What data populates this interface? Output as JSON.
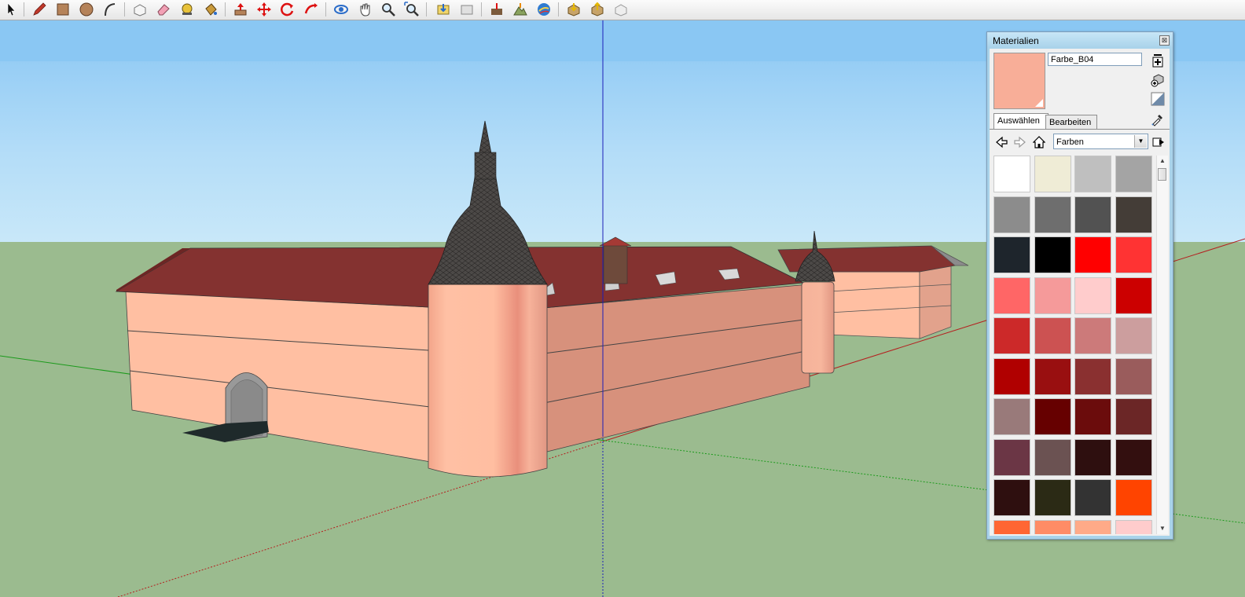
{
  "toolbar": {
    "tools": [
      "select-icon",
      "pencil-icon",
      "rectangle-icon",
      "circle-icon",
      "arc-icon",
      "make-component-icon",
      "eraser-icon",
      "tape-measure-icon",
      "paint-bucket-icon",
      "push-pull-icon",
      "move-icon",
      "rotate-icon",
      "follow-me-icon",
      "orbit-icon",
      "pan-icon",
      "zoom-icon",
      "zoom-extents-icon",
      "get-models-icon",
      "share-model-icon",
      "add-location-icon",
      "toggle-terrain-icon",
      "google-earth-icon",
      "get-components-icon",
      "share-component-icon",
      "extension-icon"
    ]
  },
  "panel": {
    "title": "Materialien",
    "close_label": "⊠",
    "material_name": "Farbe_B04",
    "current_color": "#f8ae98",
    "tabs": [
      "Auswählen",
      "Bearbeiten"
    ],
    "active_tab": "Auswählen",
    "collection": "Farben",
    "swatches": [
      "#ffffff",
      "#efecd6",
      "#bfbfbf",
      "#a4a4a4",
      "#8c8c8c",
      "#6e6e6e",
      "#525252",
      "#443d37",
      "#1e252c",
      "#000000",
      "#ff0000",
      "#ff3333",
      "#ff6666",
      "#f59a9a",
      "#ffcccc",
      "#cc0000",
      "#cc2929",
      "#cc5252",
      "#cc7a7a",
      "#cc9e9e",
      "#b00000",
      "#990f10",
      "#8a3030",
      "#9a5c5c",
      "#997a7a",
      "#660000",
      "#6b0c0c",
      "#6b2626",
      "#6b3645",
      "#6b5252",
      "#2e0f0f",
      "#330f0f",
      "#2e0f0f",
      "#2b2a15",
      "#333333",
      "#ff4400",
      "#ff6633",
      "#ff8c66",
      "#ffaa88",
      "#ffcccc"
    ]
  },
  "viewport": {
    "sky_top": "#8dc9f3",
    "sky_bottom": "#c7e6f8",
    "ground": "#9bbb8f",
    "wall_lit": "#ffbfa2",
    "wall_shade": "#d8907c",
    "roof": "#843230",
    "tower_roof": "#4f4c4a"
  }
}
